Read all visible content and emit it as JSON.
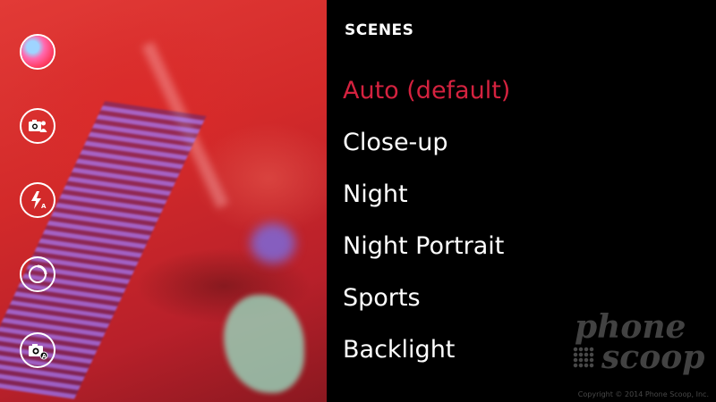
{
  "menu": {
    "title": "SCENES",
    "items": [
      {
        "label": "Auto (default)",
        "selected": true
      },
      {
        "label": "Close-up",
        "selected": false
      },
      {
        "label": "Night",
        "selected": false
      },
      {
        "label": "Night Portrait",
        "selected": false
      },
      {
        "label": "Sports",
        "selected": false
      },
      {
        "label": "Backlight",
        "selected": false
      }
    ],
    "selected_color": "#d4223f"
  },
  "controls": [
    {
      "name": "gallery-thumbnail",
      "icon": "photo-thumbnail"
    },
    {
      "name": "camera-lenses-button",
      "icon": "camera-person-icon"
    },
    {
      "name": "flash-auto-button",
      "icon": "flash-auto-icon"
    },
    {
      "name": "exposure-button",
      "icon": "exposure-dial-icon"
    },
    {
      "name": "camera-mode-button",
      "icon": "camera-auto-icon"
    }
  ],
  "watermark": {
    "line1": "phone",
    "line2": "scoop",
    "copyright": "Copyright © 2014 Phone Scoop, Inc."
  }
}
